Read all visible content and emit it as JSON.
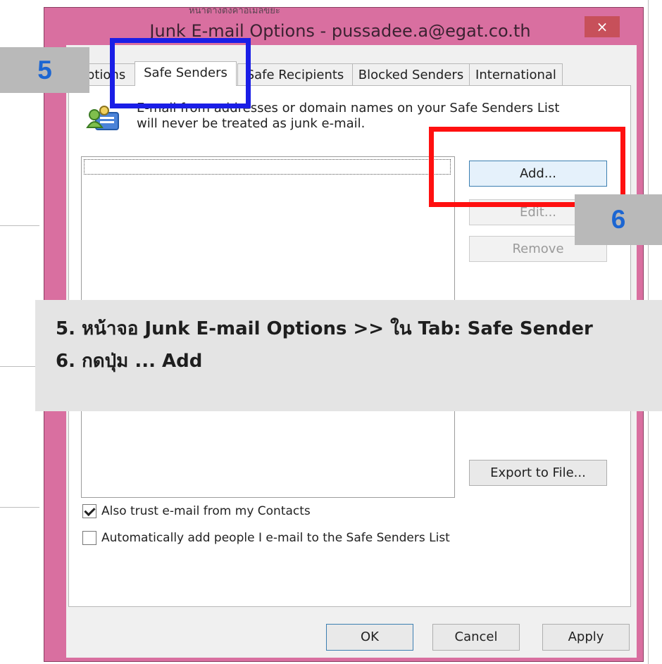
{
  "window": {
    "top_strip_text": "หน้าต่างตั้งค่าอีเมลขยะ",
    "title": "Junk E-mail Options - pussadee.a@egat.co.th",
    "close_label": "×"
  },
  "tabs": [
    {
      "label": "Options"
    },
    {
      "label": "Safe Senders"
    },
    {
      "label": "Safe Recipients"
    },
    {
      "label": "Blocked Senders"
    },
    {
      "label": "International"
    }
  ],
  "info": {
    "text": "E-mail from addresses or domain names on your Safe Senders List will never be treated as junk e-mail."
  },
  "list": {
    "items": []
  },
  "buttons": {
    "add": "Add...",
    "edit": "Edit...",
    "remove": "Remove",
    "export": "Export to File..."
  },
  "checks": [
    {
      "label": "Also trust e-mail from my Contacts",
      "checked": true
    },
    {
      "label": "Automatically add people I e-mail to the Safe Senders List",
      "checked": false
    }
  ],
  "dialog_buttons": {
    "ok": "OK",
    "cancel": "Cancel",
    "apply": "Apply"
  },
  "callouts": {
    "step5": "5",
    "step6": "6"
  },
  "note": {
    "line1": "5. หน้าจอ Junk E-mail Options >> ใน Tab: Safe Sender",
    "line2": "6. กดปุ่ม ... Add"
  },
  "colors": {
    "window_frame": "#d96fa0",
    "tab_highlight": "#1a1ee6",
    "add_highlight": "#ff1010",
    "callout_text": "#1c66d2"
  },
  "icons": {
    "info": "contacts-shield-icon",
    "close": "close-icon",
    "check": "checkmark-icon"
  }
}
